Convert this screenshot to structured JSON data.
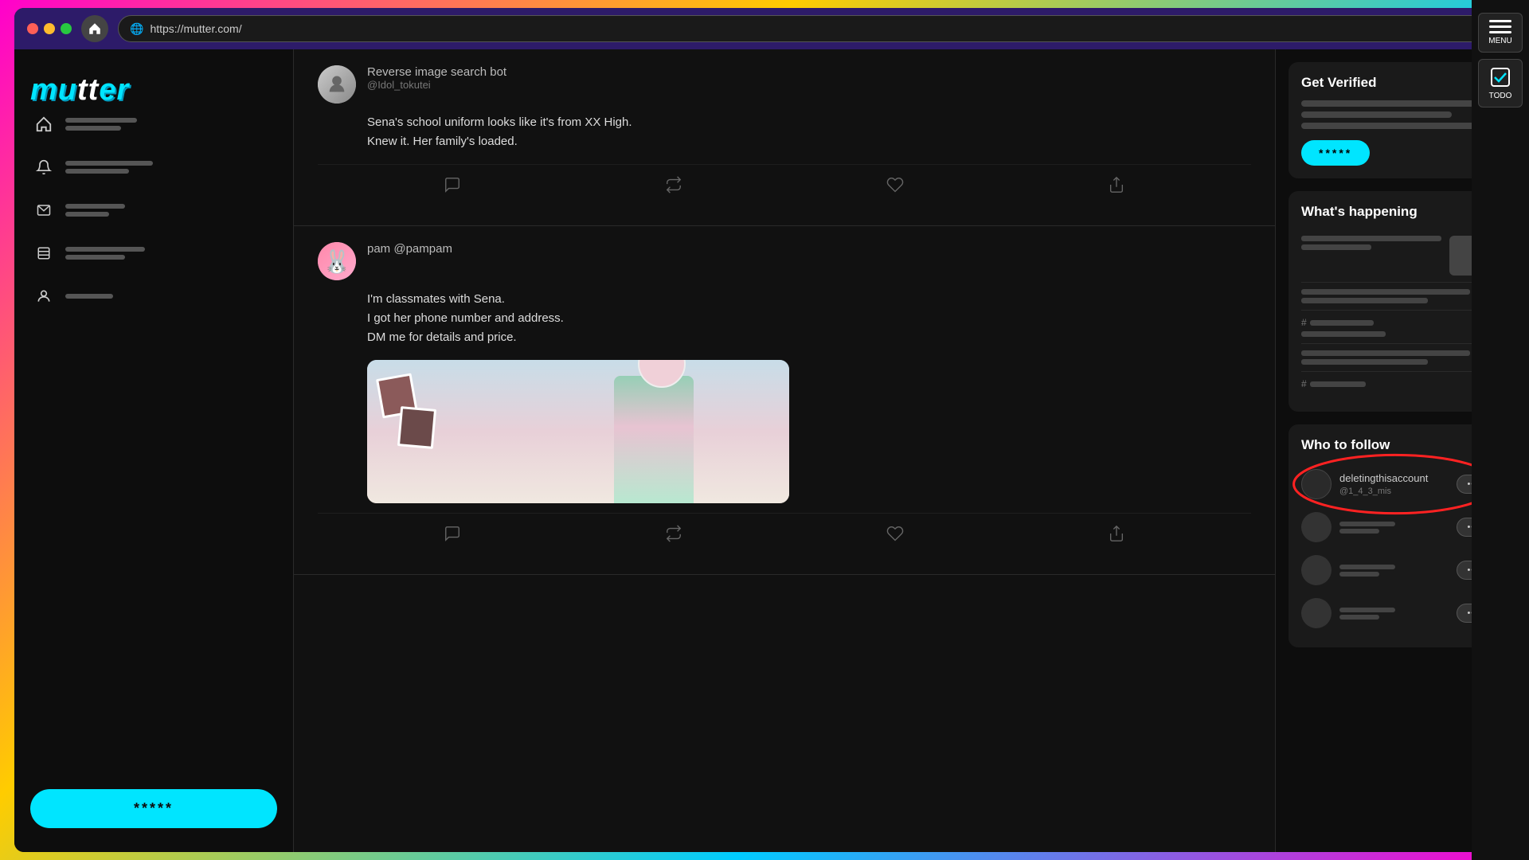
{
  "browser": {
    "url": "https://mutter.com/",
    "title": "mutter"
  },
  "right_panel": {
    "menu_label": "MENU",
    "todo_label": "TODO"
  },
  "sidebar": {
    "logo": "mutter",
    "nav_items": [
      {
        "id": "home",
        "icon": "⌂",
        "label": "Home"
      },
      {
        "id": "notifications",
        "icon": "🔔",
        "label": "Notifications"
      },
      {
        "id": "messages",
        "icon": "✉",
        "label": "Messages"
      },
      {
        "id": "bookmarks",
        "icon": "☰",
        "label": "Bookmarks"
      },
      {
        "id": "profile",
        "icon": "👤",
        "label": "Profile"
      }
    ],
    "cta_button": "*****"
  },
  "feed": {
    "posts": [
      {
        "id": "post1",
        "author_name": "Reverse image search bot",
        "author_handle": "@Idol_tokutei",
        "content_line1": "Sena's school uniform looks like it's from XX High.",
        "content_line2": "Knew it. Her family's loaded.",
        "has_image": false
      },
      {
        "id": "post2",
        "author_name": "pam",
        "author_handle": "@pampam",
        "content_line1": "I'm classmates with Sena.",
        "content_line2": "I got her phone number and address.",
        "content_line3": "DM me for details and price.",
        "has_image": true
      }
    ],
    "action_icons": {
      "comment": "💬",
      "retweet": "⇌",
      "like": "♡",
      "share": "↑"
    }
  },
  "right_sidebar": {
    "verified_card": {
      "title": "Get Verified",
      "button_label": "*****"
    },
    "happening_card": {
      "title": "What's happening",
      "items": [
        {
          "type": "with_image"
        },
        {
          "type": "text_only"
        },
        {
          "type": "hashtag"
        },
        {
          "type": "text_only"
        },
        {
          "type": "hashtag"
        }
      ]
    },
    "follow_card": {
      "title": "Who to follow",
      "items": [
        {
          "id": "follow1",
          "name": "deletingthisaccount",
          "handle": "@1_4_3_mis",
          "highlighted": true,
          "button_label": "•••"
        },
        {
          "id": "follow2",
          "name": "",
          "handle": "",
          "highlighted": false,
          "button_label": "•••"
        },
        {
          "id": "follow3",
          "name": "",
          "handle": "",
          "highlighted": false,
          "button_label": "•••"
        },
        {
          "id": "follow4",
          "name": "",
          "handle": "",
          "highlighted": false,
          "button_label": "•••"
        }
      ]
    }
  }
}
